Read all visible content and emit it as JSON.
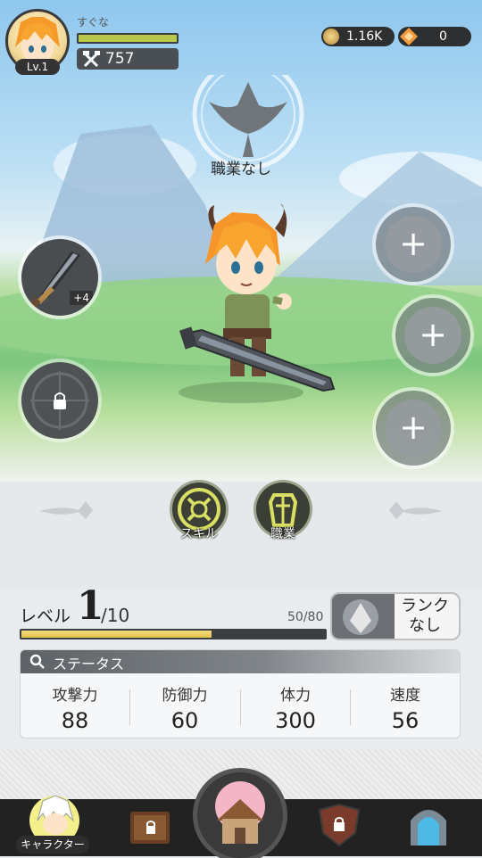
{
  "player": {
    "name": "すぐな",
    "level_label": "Lv.1",
    "exp_fraction": 1.0,
    "combat_power": "757"
  },
  "currency": {
    "gold": "1.16K",
    "gems": "0"
  },
  "job": {
    "name": "職業なし"
  },
  "equipment": {
    "weapon_plus": "+4",
    "empty_slots": [
      "+",
      "+",
      "+"
    ]
  },
  "actions": {
    "skill_label": "スキル",
    "job_label": "職業"
  },
  "level": {
    "label": "レベル",
    "current": "1",
    "max": "/10",
    "xp_text": "50/80",
    "xp_fraction": 0.625
  },
  "rank": {
    "line1": "ランク",
    "line2": "なし"
  },
  "status": {
    "title": "ステータス",
    "stats": [
      {
        "name": "攻撃力",
        "value": "88"
      },
      {
        "name": "防御力",
        "value": "60"
      },
      {
        "name": "体力",
        "value": "300"
      },
      {
        "name": "速度",
        "value": "56"
      }
    ]
  },
  "nav": {
    "active_label": "キャラクター"
  },
  "colors": {
    "exp_bar": "#b9c84a",
    "xp_bar": "#e4c24b",
    "nav_bg": "#222222"
  }
}
